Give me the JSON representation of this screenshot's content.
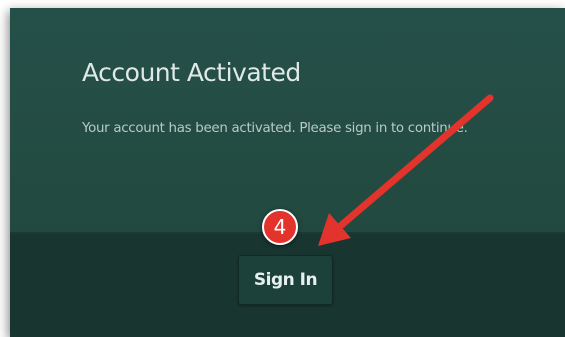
{
  "dialog": {
    "title": "Account Activated",
    "message": "Your account has been activated. Please sign in to continue.",
    "signin_label": "Sign In"
  },
  "annotation": {
    "step_number": "4",
    "badge_color": "#e2332c",
    "arrow_color": "#e2332c"
  },
  "colors": {
    "panel_background": "#255049",
    "footer_background": "#183530",
    "button_background": "#1c403a"
  }
}
